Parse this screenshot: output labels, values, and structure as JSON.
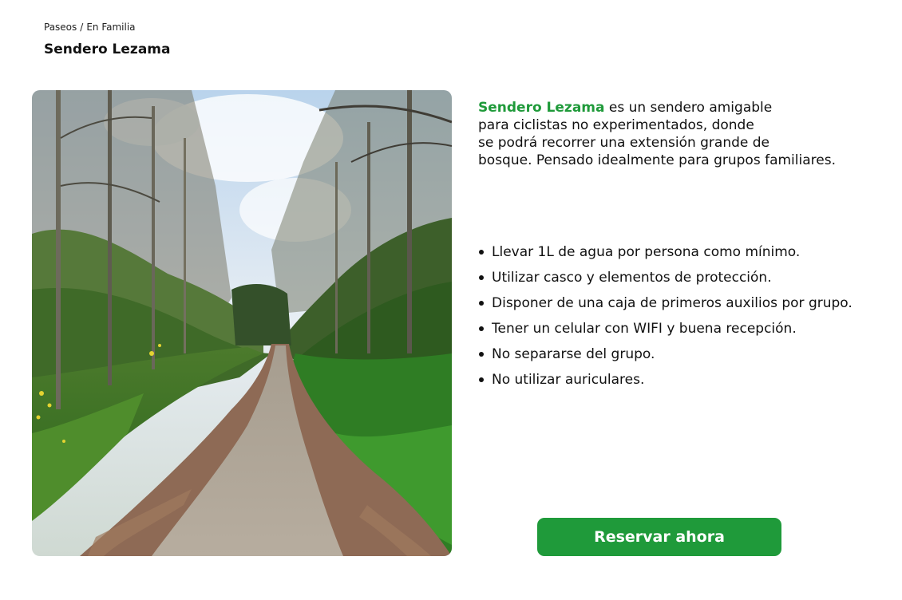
{
  "breadcrumb": {
    "items": [
      "Paseos",
      "En Familia"
    ],
    "separator": "/"
  },
  "page": {
    "title": "Sendero Lezama"
  },
  "photo": {
    "subject": "forest-trail-photo"
  },
  "description": {
    "highlight": "Sendero Lezama",
    "lines": [
      " es un sendero amigable",
      "para ciclistas no experimentados, donde",
      "se podrá recorrer una extensión grande de",
      "bosque. Pensado idealmente para grupos familiares."
    ]
  },
  "tips": [
    "Llevar 1L de agua por persona como mínimo.",
    "Utilizar casco y elementos de protección.",
    "Disponer de una caja de primeros auxilios por grupo.",
    "Tener un celular con WIFI y buena recepción.",
    "No separarse del grupo.",
    "No utilizar auriculares."
  ],
  "cta": {
    "label": "Reservar ahora"
  },
  "colors": {
    "accent": "#1f9a3a",
    "text": "#111111",
    "background": "#ffffff"
  }
}
